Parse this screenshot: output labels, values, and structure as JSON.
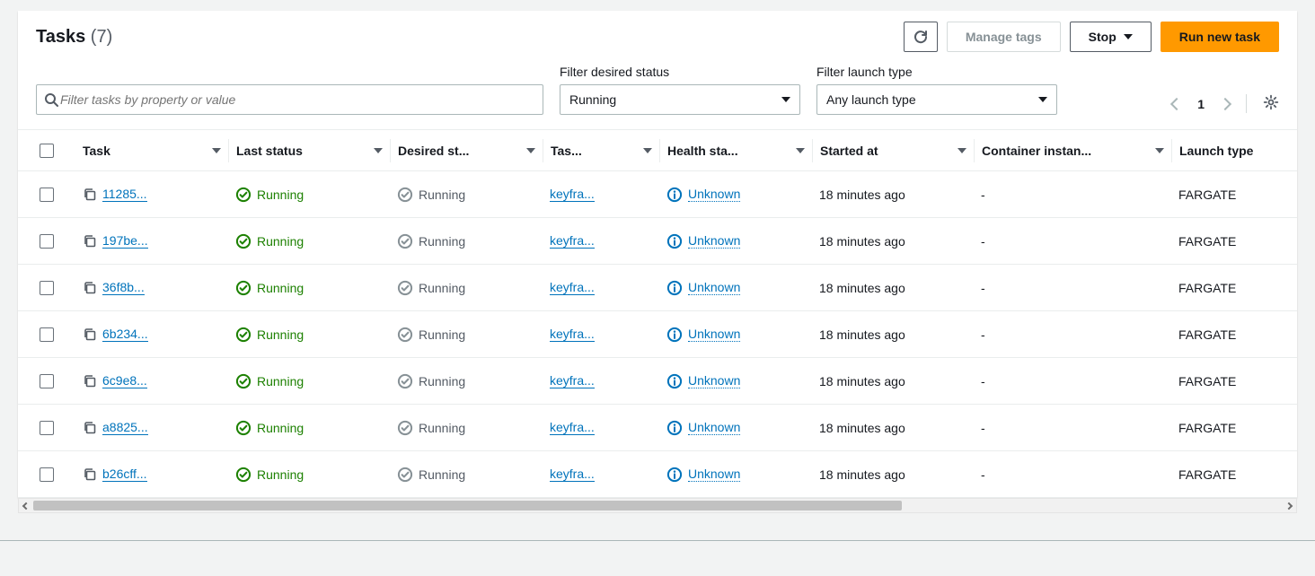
{
  "header": {
    "title": "Tasks",
    "count": "(7)",
    "refresh_label": "",
    "manage_tags": "Manage tags",
    "stop": "Stop",
    "run_new": "Run new task"
  },
  "filters": {
    "search_placeholder": "Filter tasks by property or value",
    "desired_status_label": "Filter desired status",
    "desired_status_value": "Running",
    "launch_type_label": "Filter launch type",
    "launch_type_value": "Any launch type",
    "page": "1"
  },
  "columns": {
    "task": "Task",
    "last_status": "Last status",
    "desired_status": "Desired st...",
    "task_def": "Tas...",
    "health": "Health sta...",
    "started": "Started at",
    "container_instance": "Container instan...",
    "launch_type": "Launch type"
  },
  "rows": [
    {
      "task": "11285...",
      "last_status": "Running",
      "desired_status": "Running",
      "task_def": "keyfra...",
      "health": "Unknown",
      "started": "18 minutes ago",
      "container_instance": "-",
      "launch_type": "FARGATE"
    },
    {
      "task": "197be...",
      "last_status": "Running",
      "desired_status": "Running",
      "task_def": "keyfra...",
      "health": "Unknown",
      "started": "18 minutes ago",
      "container_instance": "-",
      "launch_type": "FARGATE"
    },
    {
      "task": "36f8b...",
      "last_status": "Running",
      "desired_status": "Running",
      "task_def": "keyfra...",
      "health": "Unknown",
      "started": "18 minutes ago",
      "container_instance": "-",
      "launch_type": "FARGATE"
    },
    {
      "task": "6b234...",
      "last_status": "Running",
      "desired_status": "Running",
      "task_def": "keyfra...",
      "health": "Unknown",
      "started": "18 minutes ago",
      "container_instance": "-",
      "launch_type": "FARGATE"
    },
    {
      "task": "6c9e8...",
      "last_status": "Running",
      "desired_status": "Running",
      "task_def": "keyfra...",
      "health": "Unknown",
      "started": "18 minutes ago",
      "container_instance": "-",
      "launch_type": "FARGATE"
    },
    {
      "task": "a8825...",
      "last_status": "Running",
      "desired_status": "Running",
      "task_def": "keyfra...",
      "health": "Unknown",
      "started": "18 minutes ago",
      "container_instance": "-",
      "launch_type": "FARGATE"
    },
    {
      "task": "b26cff...",
      "last_status": "Running",
      "desired_status": "Running",
      "task_def": "keyfra...",
      "health": "Unknown",
      "started": "18 minutes ago",
      "container_instance": "-",
      "launch_type": "FARGATE"
    }
  ]
}
